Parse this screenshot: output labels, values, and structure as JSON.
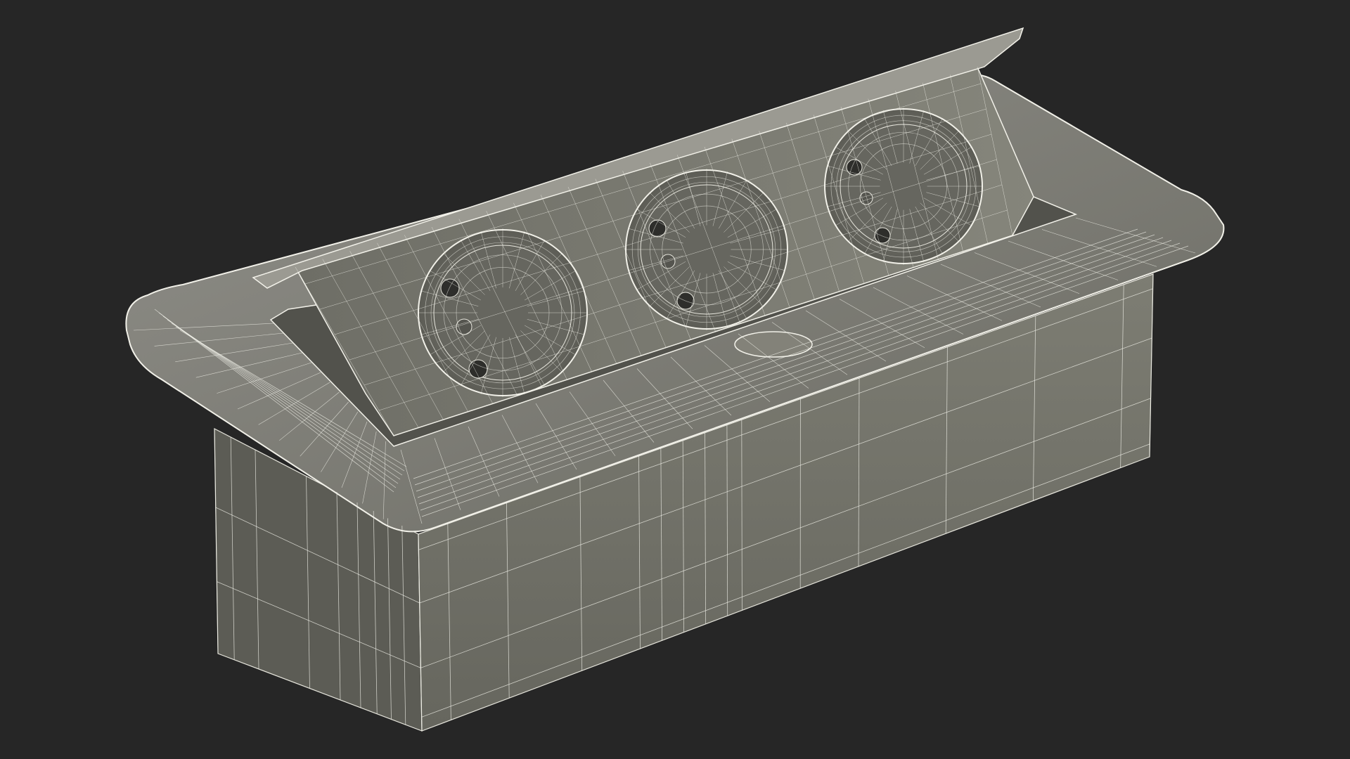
{
  "scene": {
    "background_color": "#262626",
    "model_fill_light": "#8d8c82",
    "model_fill_mid": "#75756b",
    "model_fill_dark": "#5e5e56",
    "model_fill_shadow": "#4f4f49",
    "wire_color": "#f2f1e9",
    "socket_count": 3,
    "socket_pin_holes_per_socket": 3
  }
}
